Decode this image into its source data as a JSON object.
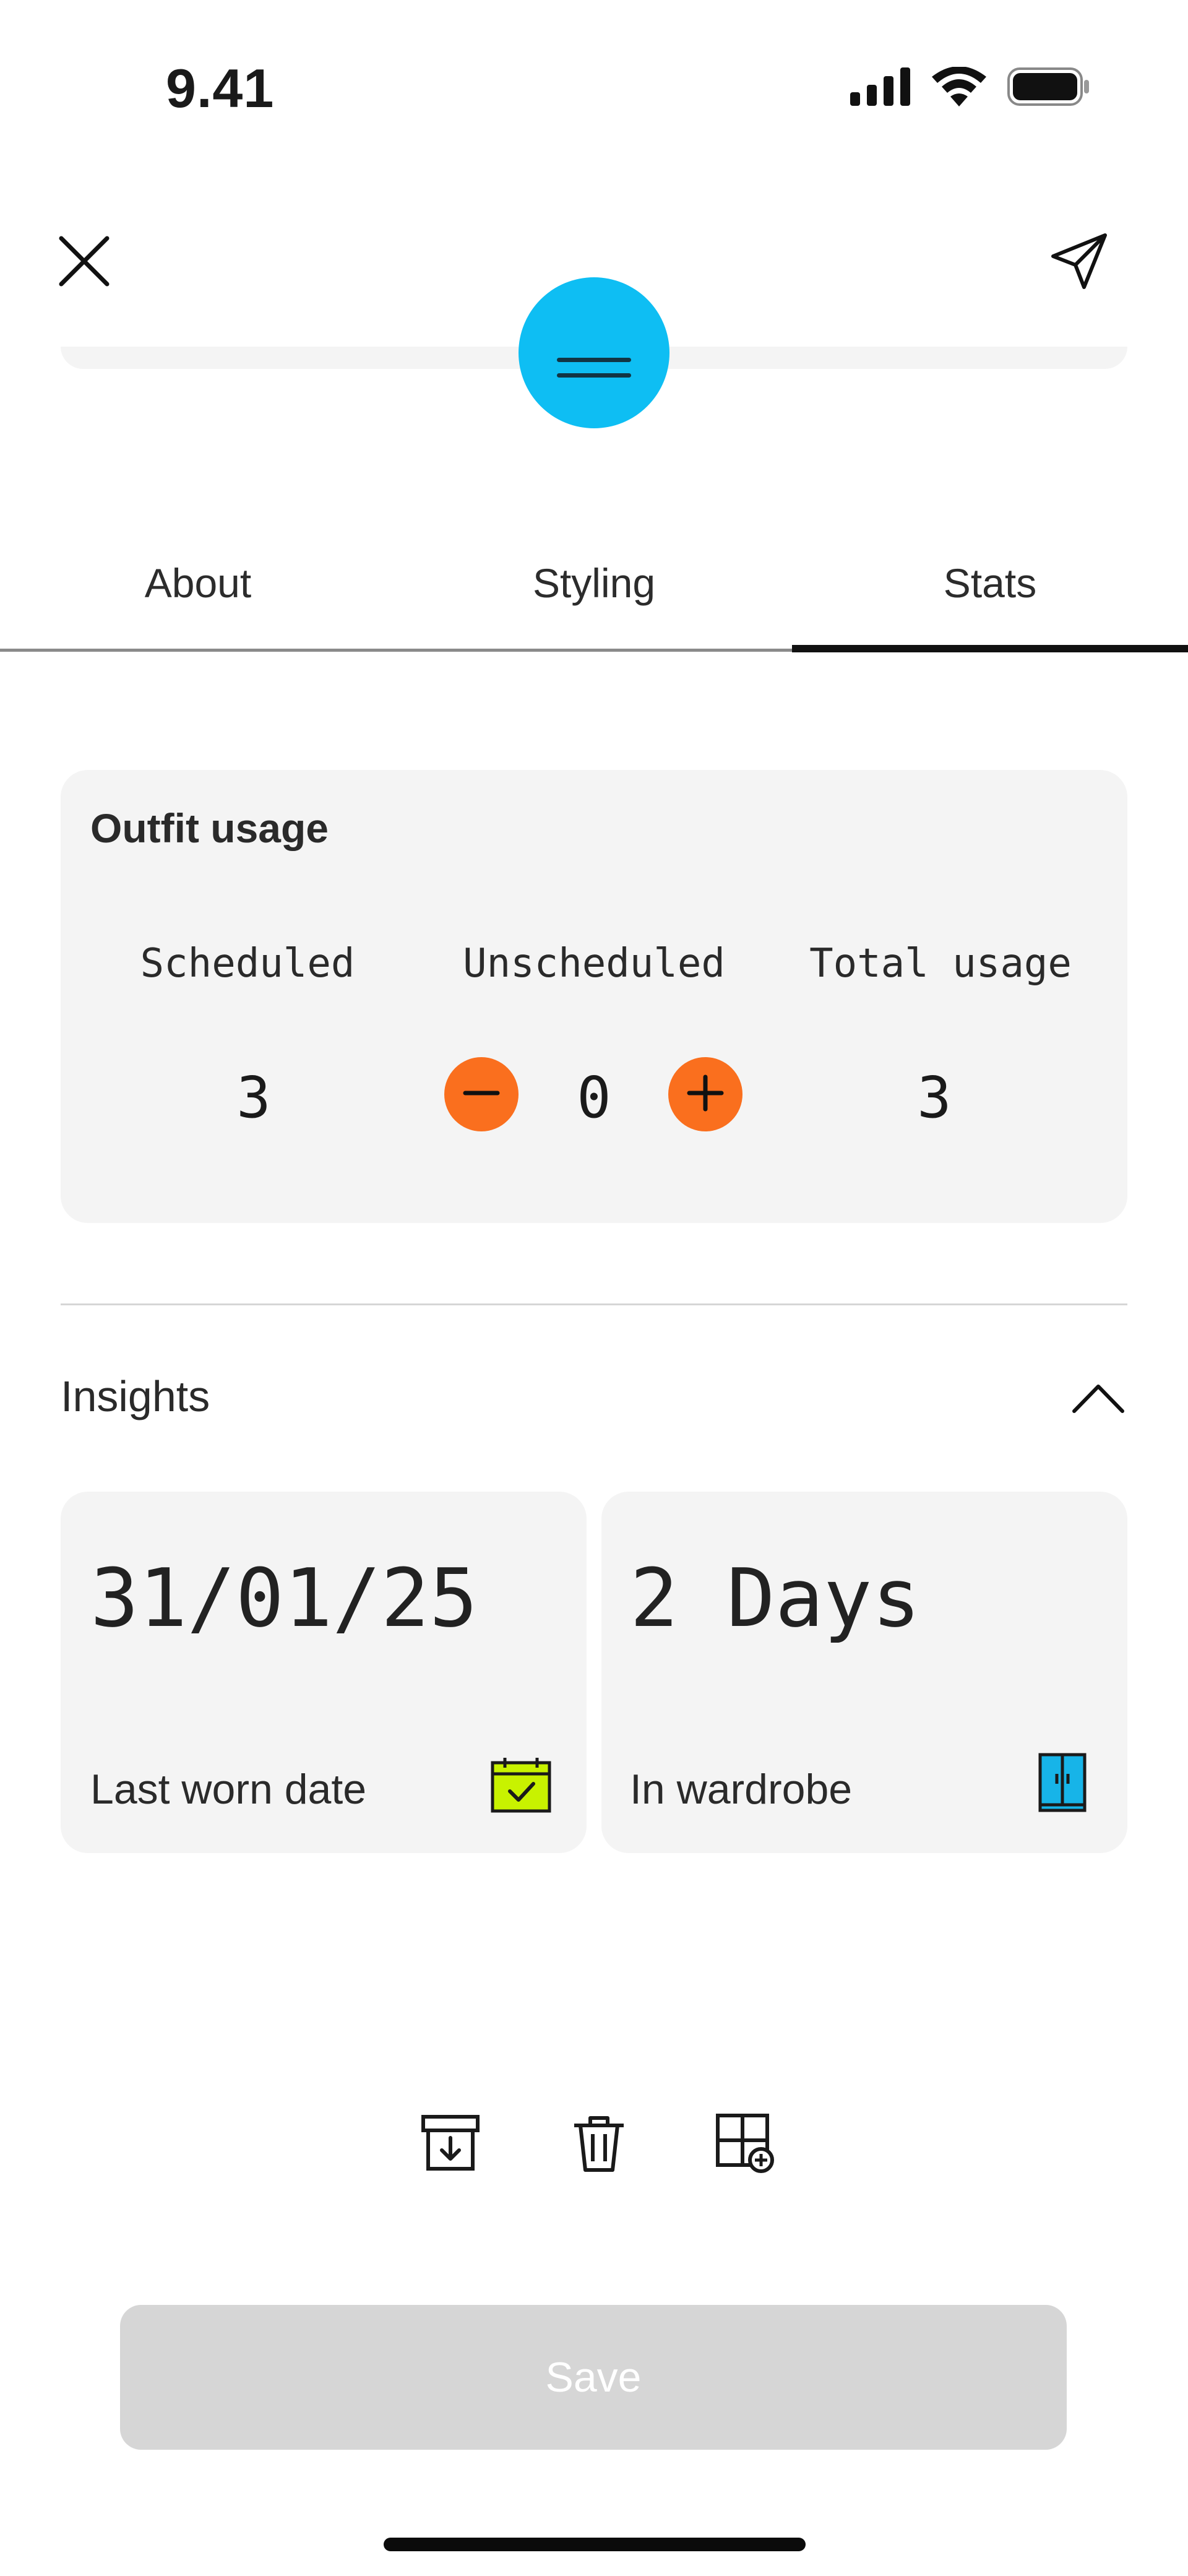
{
  "status_bar": {
    "time": "9.41",
    "icons": [
      "signal-icon",
      "wifi-icon",
      "battery-icon"
    ]
  },
  "nav": {
    "close_icon": "close-icon",
    "share_icon": "send-icon"
  },
  "tabs": [
    {
      "label": "About",
      "active": false
    },
    {
      "label": "Styling",
      "active": false
    },
    {
      "label": "Stats",
      "active": true
    }
  ],
  "outfit_usage": {
    "title": "Outfit usage",
    "columns": [
      {
        "label": "Scheduled",
        "value": "3"
      },
      {
        "label": "Unscheduled",
        "value": "0"
      },
      {
        "label": "Total usage",
        "value": "3"
      }
    ]
  },
  "insights": {
    "title": "Insights",
    "cards": [
      {
        "value": "31/01/25",
        "label": "Last worn date",
        "icon": "calendar-check-icon",
        "icon_color": "#c8f200"
      },
      {
        "value": "2 Days",
        "label": "In wardrobe",
        "icon": "wardrobe-icon",
        "icon_color": "#17b4e8"
      }
    ]
  },
  "actions": [
    "archive-icon",
    "trash-icon",
    "add-to-grid-icon"
  ],
  "save_button": {
    "label": "Save",
    "enabled": false
  },
  "colors": {
    "accent_blue": "#0ebef3",
    "stepper_orange": "#fa6f1e",
    "card_bg": "#f4f4f4",
    "disabled_button": "#d6d6d6"
  }
}
